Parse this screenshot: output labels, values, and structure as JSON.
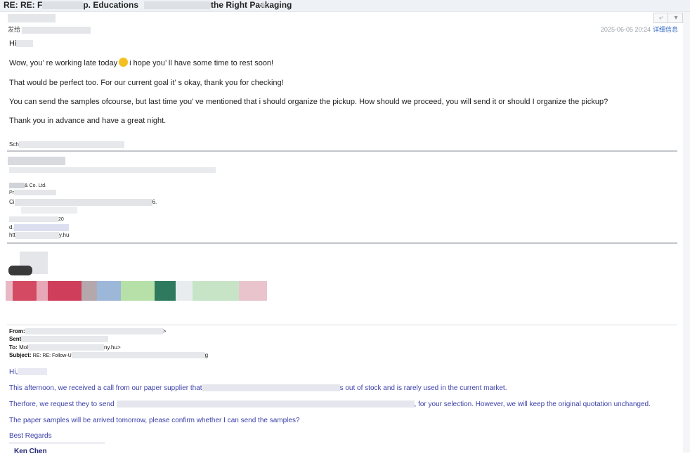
{
  "title": {
    "prefix": "RE: RE: F",
    "middle_visible": "p. Educations",
    "suffix": "the Right Packaging"
  },
  "icons": {
    "star": "star-icon",
    "reply": "reply-icon",
    "more": "chevron-down-icon"
  },
  "meta": {
    "sender_label": "发给",
    "date": "2025-06-05 20:24",
    "details_link": "详细信息"
  },
  "message": {
    "greeting": "Hi",
    "line1_a": "Wow, you’  re working late today",
    "line1_b": "i hope you’  ll have some time to rest soon!",
    "line2": "That would be perfect too. For our current goal it’  s okay, thank you for checking!",
    "line3": "You can send the samples ofcourse, but last time you’   ve mentioned that i should organize the pickup. How should we proceed, you will send it or should I organize the pickup?",
    "line4": "Thank you in advance and have a great night.",
    "signoff": "Sch"
  },
  "signature": {
    "company": "& Co. Ltd.",
    "line_pr": "Pr",
    "line_ci": "Ci",
    "line_ci_end": "6.",
    "line_num": "20",
    "line_d": "d.",
    "line_url_start": "htt",
    "line_url_end": "y.hu"
  },
  "quoted_header": {
    "from_label": "From:",
    "from_end": ">",
    "sent_label": "Sent",
    "to_label": "To:",
    "to_value_start": "Mol",
    "to_value_end": "ny.hu>",
    "subject_label": "Subject:",
    "subject_value": "RE: RE: Follow-U",
    "subject_end": "g"
  },
  "quoted": {
    "greeting": "Hi,",
    "p1_a": "This afternoon, we received a call from our paper supplier that",
    "p1_b": "s out of stock and is rarely used in the current market.",
    "p2_a": "Therfore, we request they to send",
    "p2_b": ", for your selection. However, we will keep the original quotation unchanged.",
    "p3": "The paper samples will be arrived tomorrow, please confirm whether I can send the samples?",
    "regards": "Best Regards",
    "name": "Ken Chen"
  },
  "colors": {
    "quoted_text": "#3a3fa8",
    "link": "#3b6fc7",
    "titlebar": "#eef2f7"
  }
}
